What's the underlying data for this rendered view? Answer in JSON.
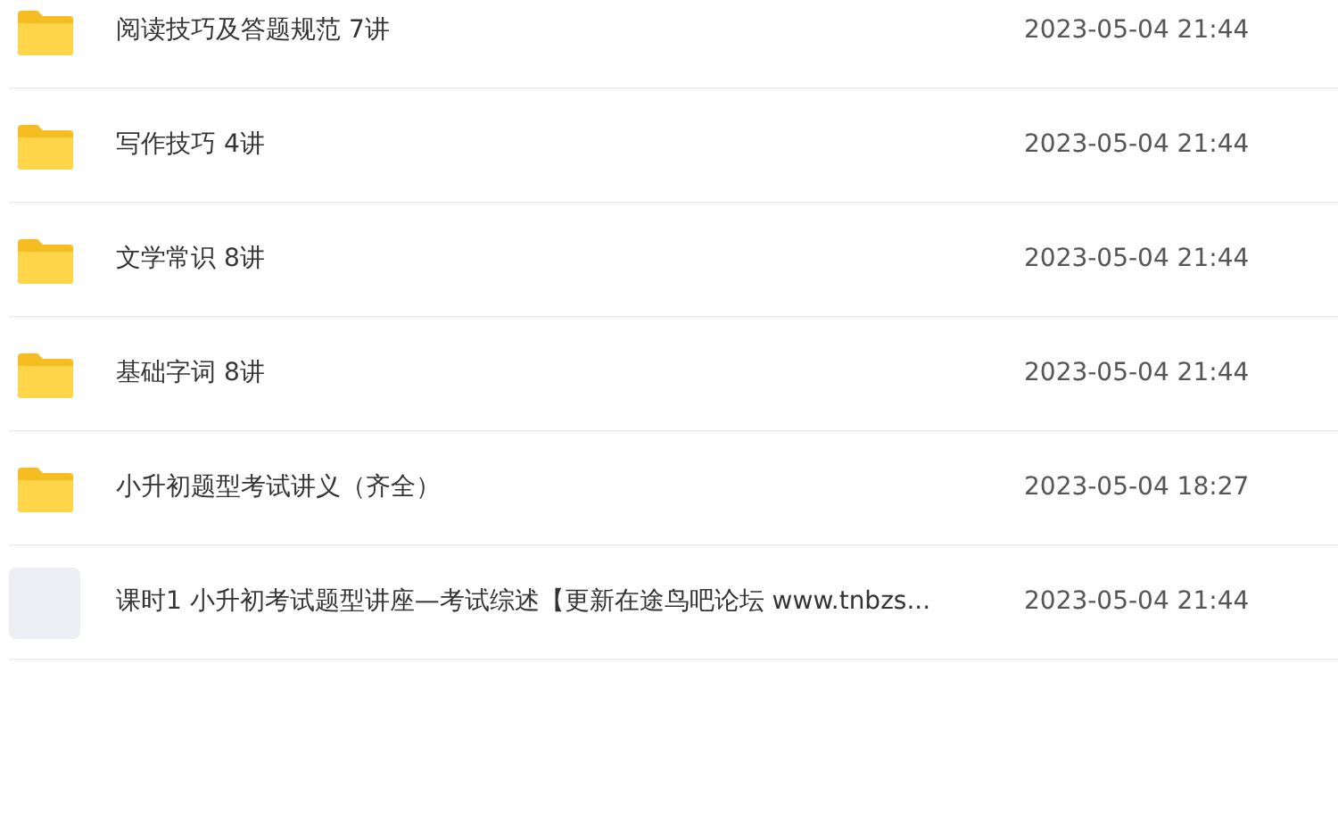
{
  "files": [
    {
      "kind": "folder",
      "name": "阅读技巧及答题规范 7讲",
      "modified": "2023-05-04 21:44"
    },
    {
      "kind": "folder",
      "name": "写作技巧 4讲",
      "modified": "2023-05-04 21:44"
    },
    {
      "kind": "folder",
      "name": "文学常识 8讲",
      "modified": "2023-05-04 21:44"
    },
    {
      "kind": "folder",
      "name": "基础字词 8讲",
      "modified": "2023-05-04 21:44"
    },
    {
      "kind": "folder",
      "name": "小升初题型考试讲义（齐全）",
      "modified": "2023-05-04 18:27"
    },
    {
      "kind": "file",
      "name": "课时1 小升初考试题型讲座—考试综述【更新在途鸟吧论坛 www.tnbzs...",
      "modified": "2023-05-04 21:44"
    }
  ]
}
